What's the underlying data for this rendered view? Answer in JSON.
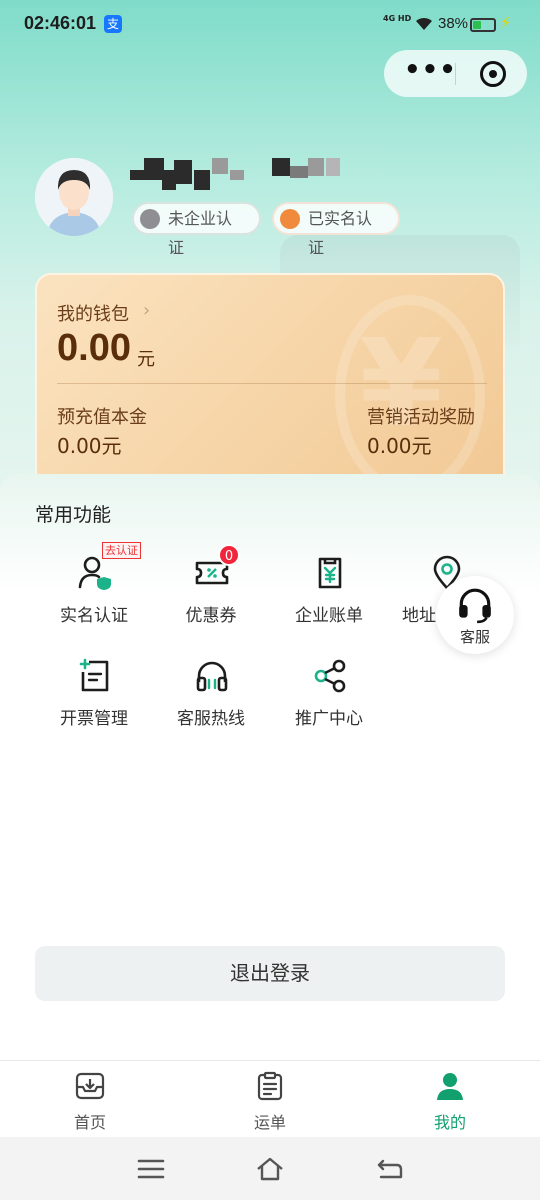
{
  "status_bar": {
    "time": "02:46:01",
    "alipay_glyph": "支",
    "network": "4G HD",
    "battery_percent": "38%",
    "battery_level": 0.38
  },
  "capsule": {
    "more_glyph": "•••"
  },
  "profile": {
    "badge_enterprise": "未企业认证",
    "badge_realname": "已实名认证"
  },
  "wallet": {
    "title": "我的钱包",
    "arrow": "›",
    "amount": "0.00",
    "unit": "元",
    "prepaid_label": "预充值本金",
    "prepaid_value": "0.00元",
    "reward_label": "营销活动奖励",
    "reward_value": "0.00元"
  },
  "functions": {
    "title": "常用功能",
    "items": [
      {
        "label": "实名认证"
      },
      {
        "label": "优惠券"
      },
      {
        "label": "企业账单"
      },
      {
        "label": "地址"
      },
      {
        "label": "开票管理"
      },
      {
        "label": "客服热线"
      },
      {
        "label": "推广中心"
      }
    ],
    "verify_tag": "去认证",
    "coupon_count": "0"
  },
  "service_float": {
    "label": "客服"
  },
  "logout_label": "退出登录",
  "tabbar": {
    "items": [
      {
        "label": "首页"
      },
      {
        "label": "运单"
      },
      {
        "label": "我的"
      }
    ]
  },
  "colors": {
    "accent": "#12a06f",
    "badge_red": "#f0263a"
  }
}
